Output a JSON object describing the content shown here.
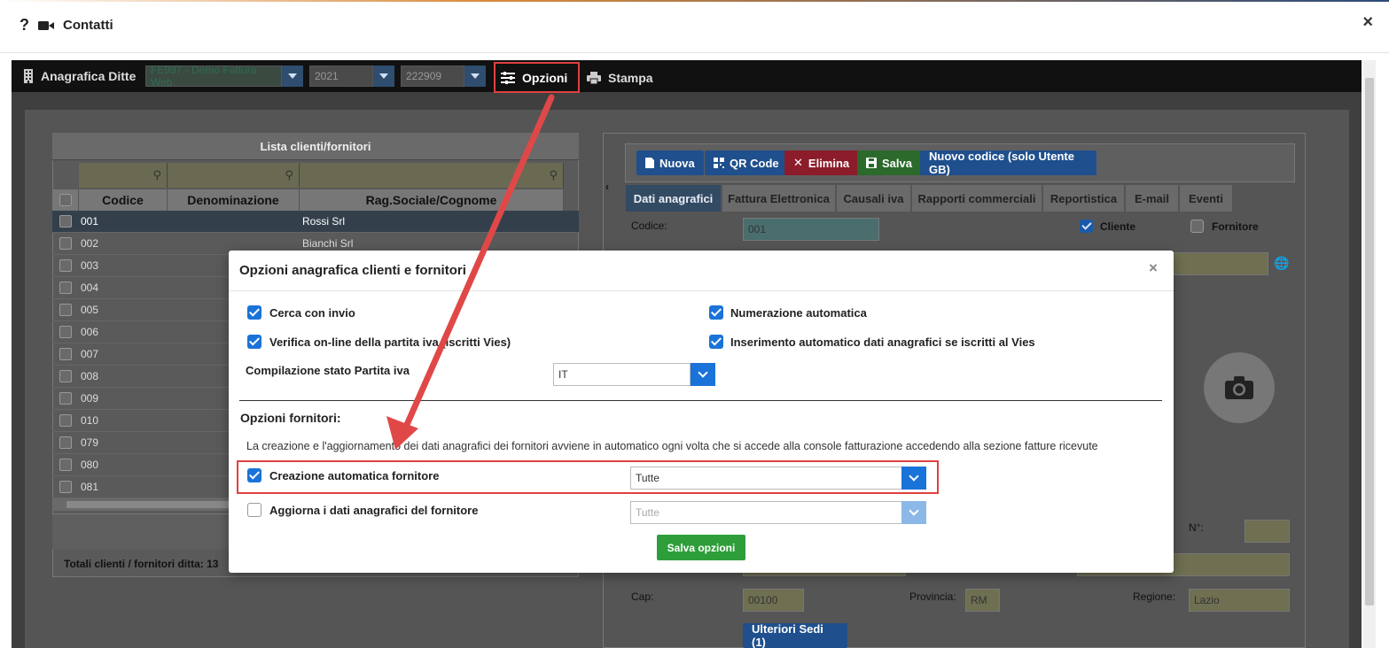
{
  "window": {
    "help_label": "?",
    "title": "Contatti",
    "close_label": "×"
  },
  "toolbar": {
    "anagrafica_label": "Anagrafica Ditte",
    "company_value": "FE997 - Demo Fattura Web",
    "year_value": "2021",
    "code_value": "222909",
    "opzioni_label": "Opzioni",
    "stampa_label": "Stampa"
  },
  "list": {
    "title": "Lista clienti/fornitori",
    "headers": [
      "Codice",
      "Denominazione",
      "Rag.Sociale/Cognome"
    ],
    "rows": [
      {
        "code": "001",
        "rag": "Rossi Srl"
      },
      {
        "code": "002",
        "rag": "Bianchi Srl"
      },
      {
        "code": "003",
        "rag": ""
      },
      {
        "code": "004",
        "rag": ""
      },
      {
        "code": "005",
        "rag": ""
      },
      {
        "code": "006",
        "rag": ""
      },
      {
        "code": "007",
        "rag": ""
      },
      {
        "code": "008",
        "rag": ""
      },
      {
        "code": "009",
        "rag": ""
      },
      {
        "code": "010",
        "rag": ""
      },
      {
        "code": "079",
        "rag": ""
      },
      {
        "code": "080",
        "rag": ""
      },
      {
        "code": "081",
        "rag": ""
      }
    ],
    "totals": "Totali clienti / fornitori ditta: 13"
  },
  "detail": {
    "buttons": {
      "nuova": "Nuova",
      "qr": "QR Code",
      "elimina": "Elimina",
      "salva": "Salva",
      "nuovo_codice": "Nuovo codice (solo Utente GB)"
    },
    "tabs": [
      "Dati anagrafici",
      "Fattura Elettronica",
      "Causali iva",
      "Rapporti commerciali",
      "Reportistica",
      "E-mail",
      "Eventi"
    ],
    "codice_label": "Codice:",
    "codice_value": "001",
    "cliente_label": "Cliente",
    "fornitore_label": "Fornitore",
    "numero_label": "N°:",
    "cap_label": "Cap:",
    "cap_value": "00100",
    "provincia_label": "Provincia:",
    "provincia_value": "RM",
    "regione_label": "Regione:",
    "regione_value": "Lazio",
    "ulteriori_sedi": "Ulteriori Sedi (1)"
  },
  "modal": {
    "title": "Opzioni anagrafica clienti e fornitori",
    "close_label": "×",
    "cerca_con_invio": "Cerca con invio",
    "numerazione_automatica": "Numerazione automatica",
    "verifica_online": "Verifica on-line della partita iva (iscritti Vies)",
    "inserimento_automatico": "Inserimento automatico dati anagrafici se iscritti al Vies",
    "compilazione_label": "Compilazione stato Partita iva",
    "compilazione_value": "IT",
    "opzioni_fornitori": "Opzioni fornitori:",
    "info_text": "La creazione e l'aggiornamento dei dati anagrafici dei fornitori avviene in automatico ogni volta che si accede alla console fatturazione accedendo alla sezione fatture ricevute",
    "creazione_label": "Creazione automatica fornitore",
    "creazione_value": "Tutte",
    "aggiorna_label": "Aggiorna i dati anagrafici del fornitore",
    "aggiorna_value": "Tutte",
    "salva_opzioni": "Salva opzioni"
  },
  "colors": {
    "accent_blue": "#1a73d9",
    "highlight_red": "#e04040",
    "save_green": "#2e9e3a"
  }
}
